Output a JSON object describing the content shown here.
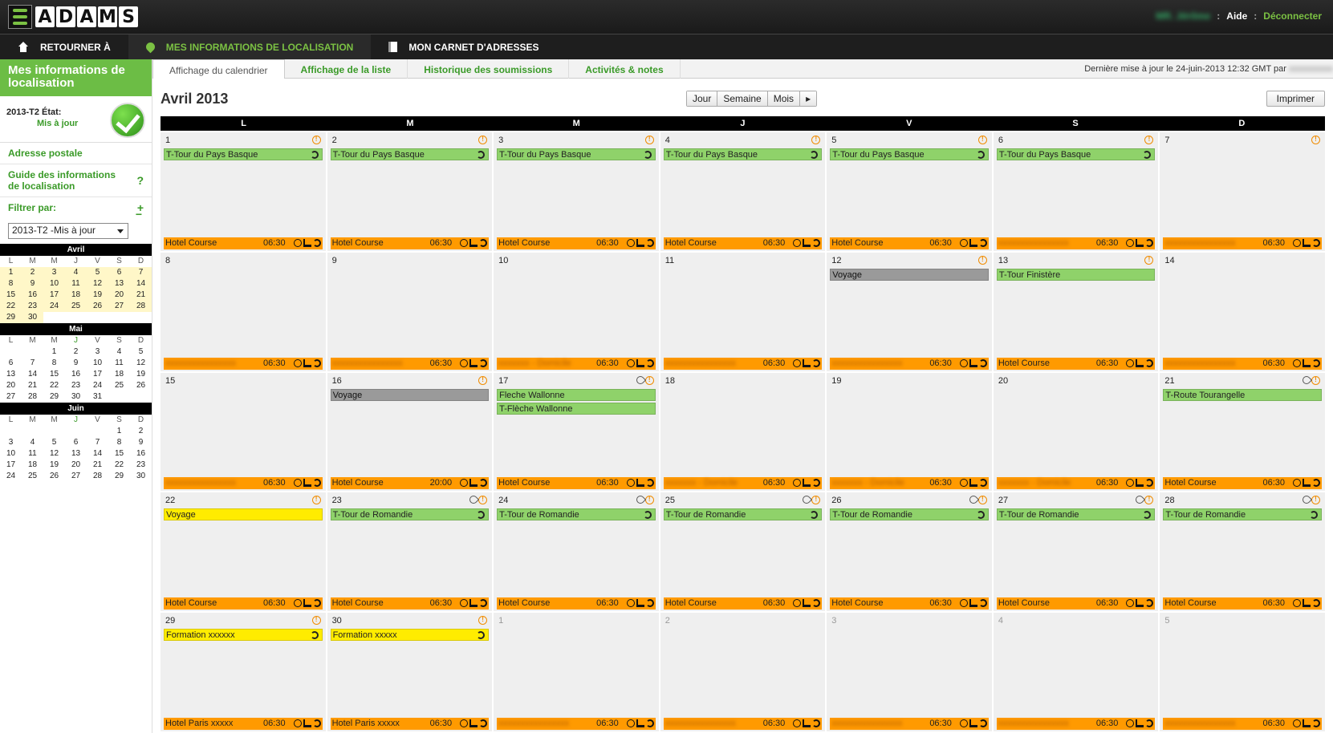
{
  "header": {
    "logo_letters": [
      "A",
      "D",
      "A",
      "M",
      "S"
    ],
    "user": "MR. Jérôme",
    "separator": ":",
    "help": "Aide",
    "logout": "Déconnecter"
  },
  "nav": [
    {
      "label": "RETOURNER À",
      "icon": "home-icon"
    },
    {
      "label": "MES INFORMATIONS DE LOCALISATION",
      "icon": "location-pin-icon",
      "active": true
    },
    {
      "label": "MON CARNET D'ADRESSES",
      "icon": "address-book-icon"
    }
  ],
  "sidebar": {
    "title": "Mes informations de localisation",
    "state_label": "2013-T2 État:",
    "state_value": "Mis à jour",
    "postal": "Adresse postale",
    "guide": "Guide des informations de localisation",
    "guide_side": "?",
    "filter": "Filtrer par:",
    "filter_plus": "+",
    "filter_minus": "−",
    "filter_value": "2013-T2 -Mis à jour"
  },
  "minical": {
    "dow": [
      "L",
      "M",
      "M",
      "J",
      "V",
      "S",
      "D"
    ],
    "months": [
      {
        "name": "Avril",
        "weeks": [
          [
            "1",
            "2",
            "3",
            "4",
            "5",
            "6",
            "7"
          ],
          [
            "8",
            "9",
            "10",
            "11",
            "12",
            "13",
            "14"
          ],
          [
            "15",
            "16",
            "17",
            "18",
            "19",
            "20",
            "21"
          ],
          [
            "22",
            "23",
            "24",
            "25",
            "26",
            "27",
            "28"
          ],
          [
            "29",
            "30",
            "",
            "",
            "",
            "",
            ""
          ]
        ]
      },
      {
        "name": "Mai",
        "weeks": [
          [
            "",
            "",
            "1",
            "2",
            "3",
            "4",
            "5"
          ],
          [
            "6",
            "7",
            "8",
            "9",
            "10",
            "11",
            "12"
          ],
          [
            "13",
            "14",
            "15",
            "16",
            "17",
            "18",
            "19"
          ],
          [
            "20",
            "21",
            "22",
            "23",
            "24",
            "25",
            "26"
          ],
          [
            "27",
            "28",
            "29",
            "30",
            "31",
            "",
            ""
          ]
        ]
      },
      {
        "name": "Juin",
        "weeks": [
          [
            "",
            "",
            "",
            "",
            "",
            "1",
            "2"
          ],
          [
            "3",
            "4",
            "5",
            "6",
            "7",
            "8",
            "9"
          ],
          [
            "10",
            "11",
            "12",
            "13",
            "14",
            "15",
            "16"
          ],
          [
            "17",
            "18",
            "19",
            "20",
            "21",
            "22",
            "23"
          ],
          [
            "24",
            "25",
            "26",
            "27",
            "28",
            "29",
            "30"
          ]
        ]
      }
    ]
  },
  "tabs": [
    "Affichage du calendrier",
    "Affichage de la liste",
    "Historique des soumissions",
    "Activités & notes"
  ],
  "last_update": "Dernière mise à jour le 24-juin-2013 12:32 GMT par",
  "last_update_user": "xxxxxxxxxx",
  "calendar": {
    "title": "Avril 2013",
    "views": [
      "Jour",
      "Semaine",
      "Mois",
      "▸"
    ],
    "print": "Imprimer",
    "dow": [
      "L",
      "M",
      "M",
      "J",
      "V",
      "S",
      "D"
    ],
    "cells": [
      {
        "n": "1",
        "warn": true,
        "events": [
          {
            "t": "T-Tour du Pays Basque",
            "c": "green",
            "rot": true
          }
        ],
        "bar": {
          "label": "Hotel Course",
          "time": "06:30"
        }
      },
      {
        "n": "2",
        "warn": true,
        "events": [
          {
            "t": "T-Tour du Pays Basque",
            "c": "green",
            "rot": true
          }
        ],
        "bar": {
          "label": "Hotel Course",
          "time": "06:30"
        }
      },
      {
        "n": "3",
        "warn": true,
        "events": [
          {
            "t": "T-Tour du Pays Basque",
            "c": "green",
            "rot": true
          }
        ],
        "bar": {
          "label": "Hotel Course",
          "time": "06:30"
        }
      },
      {
        "n": "4",
        "warn": true,
        "events": [
          {
            "t": "T-Tour du Pays Basque",
            "c": "green",
            "rot": true
          }
        ],
        "bar": {
          "label": "Hotel Course",
          "time": "06:30"
        }
      },
      {
        "n": "5",
        "warn": true,
        "events": [
          {
            "t": "T-Tour du Pays Basque",
            "c": "green",
            "rot": true
          }
        ],
        "bar": {
          "label": "Hotel Course",
          "time": "06:30"
        }
      },
      {
        "n": "6",
        "warn": true,
        "events": [
          {
            "t": "T-Tour du Pays Basque",
            "c": "green",
            "rot": true
          }
        ],
        "bar": {
          "label": "xxxxxxxxxxxxxxxx",
          "time": "06:30",
          "redact": true
        }
      },
      {
        "n": "7",
        "warn": true,
        "events": [],
        "bar": {
          "label": "xxxxxxxxxxxxxxxx",
          "time": "06:30",
          "redact": true
        }
      },
      {
        "n": "8",
        "events": [],
        "bar": {
          "label": "xxxxxxxxxxxxxxxx",
          "time": "06:30",
          "redact": true
        }
      },
      {
        "n": "9",
        "events": [],
        "bar": {
          "label": "xxxxxxxxxxxxxxxx",
          "time": "06:30",
          "redact": true
        }
      },
      {
        "n": "10",
        "events": [],
        "bar": {
          "label": "xxxxxxx - Domicile",
          "time": "06:30",
          "redact": true
        }
      },
      {
        "n": "11",
        "events": [],
        "bar": {
          "label": "xxxxxxxxxxxxxxxx",
          "time": "06:30",
          "redact": true
        }
      },
      {
        "n": "12",
        "warn": true,
        "events": [
          {
            "t": "Voyage",
            "c": "gray"
          }
        ],
        "bar": {
          "label": "xxxxxxxxxxxxxxxx",
          "time": "06:30",
          "redact": true
        }
      },
      {
        "n": "13",
        "warn": true,
        "events": [
          {
            "t": "T-Tour Finistère",
            "c": "green"
          }
        ],
        "bar": {
          "label": "Hotel Course",
          "time": "06:30"
        }
      },
      {
        "n": "14",
        "events": [],
        "bar": {
          "label": "xxxxxxxxxxxxxxxx",
          "time": "06:30",
          "redact": true
        }
      },
      {
        "n": "15",
        "events": [],
        "bar": {
          "label": "xxxxxxxxxxxxxxxx",
          "time": "06:30",
          "redact": true
        }
      },
      {
        "n": "16",
        "warn": true,
        "events": [
          {
            "t": "Voyage",
            "c": "gray"
          }
        ],
        "bar": {
          "label": "Hotel Course",
          "time": "20:00"
        }
      },
      {
        "n": "17",
        "warn": true,
        "clip": true,
        "events": [
          {
            "t": "Fleche Wallonne",
            "c": "green"
          },
          {
            "t": "T-Flèche Wallonne",
            "c": "green"
          }
        ],
        "bar": {
          "label": "Hotel Course",
          "time": "06:30"
        }
      },
      {
        "n": "18",
        "events": [],
        "bar": {
          "label": "xxxxxxx - Domicile",
          "time": "06:30",
          "redact": true
        }
      },
      {
        "n": "19",
        "events": [],
        "bar": {
          "label": "xxxxxxx - Domicile",
          "time": "06:30",
          "redact": true
        }
      },
      {
        "n": "20",
        "events": [],
        "bar": {
          "label": "xxxxxxx - Domicile",
          "time": "06:30",
          "redact": true
        }
      },
      {
        "n": "21",
        "warn": true,
        "clip": true,
        "events": [
          {
            "t": "T-Route Tourangelle",
            "c": "green"
          }
        ],
        "bar": {
          "label": "Hotel Course",
          "time": "06:30"
        }
      },
      {
        "n": "22",
        "warn": true,
        "events": [
          {
            "t": "Voyage",
            "c": "yellow"
          }
        ],
        "bar": {
          "label": "Hotel Course",
          "time": "06:30"
        }
      },
      {
        "n": "23",
        "warn": true,
        "clip": true,
        "events": [
          {
            "t": "T-Tour de Romandie",
            "c": "green",
            "rot": true
          }
        ],
        "bar": {
          "label": "Hotel Course",
          "time": "06:30"
        }
      },
      {
        "n": "24",
        "warn": true,
        "clip": true,
        "events": [
          {
            "t": "T-Tour de Romandie",
            "c": "green",
            "rot": true
          }
        ],
        "bar": {
          "label": "Hotel Course",
          "time": "06:30"
        }
      },
      {
        "n": "25",
        "warn": true,
        "clip": true,
        "events": [
          {
            "t": "T-Tour de Romandie",
            "c": "green",
            "rot": true
          }
        ],
        "bar": {
          "label": "Hotel Course",
          "time": "06:30"
        }
      },
      {
        "n": "26",
        "warn": true,
        "clip": true,
        "events": [
          {
            "t": "T-Tour de Romandie",
            "c": "green",
            "rot": true
          }
        ],
        "bar": {
          "label": "Hotel Course",
          "time": "06:30"
        }
      },
      {
        "n": "27",
        "warn": true,
        "clip": true,
        "events": [
          {
            "t": "T-Tour de Romandie",
            "c": "green",
            "rot": true
          }
        ],
        "bar": {
          "label": "Hotel Course",
          "time": "06:30"
        }
      },
      {
        "n": "28",
        "warn": true,
        "clip": true,
        "events": [
          {
            "t": "T-Tour de Romandie",
            "c": "green",
            "rot": true
          }
        ],
        "bar": {
          "label": "Hotel Course",
          "time": "06:30"
        }
      },
      {
        "n": "29",
        "warn": true,
        "events": [
          {
            "t": "Formation xxxxxx",
            "c": "yellow",
            "rot": true
          }
        ],
        "bar": {
          "label": "Hotel Paris xxxxx",
          "time": "06:30"
        }
      },
      {
        "n": "30",
        "warn": true,
        "events": [
          {
            "t": "Formation xxxxx",
            "c": "yellow",
            "rot": true
          }
        ],
        "bar": {
          "label": "Hotel Paris xxxxx",
          "time": "06:30"
        }
      },
      {
        "n": "1",
        "other": true,
        "events": [],
        "bar": {
          "label": "xxxxxxxxxxxxxxxx",
          "time": "06:30",
          "redact": true
        }
      },
      {
        "n": "2",
        "other": true,
        "events": [],
        "bar": {
          "label": "xxxxxxxxxxxxxxxx",
          "time": "06:30",
          "redact": true
        }
      },
      {
        "n": "3",
        "other": true,
        "events": [],
        "bar": {
          "label": "xxxxxxxxxxxxxxxx",
          "time": "06:30",
          "redact": true
        }
      },
      {
        "n": "4",
        "other": true,
        "events": [],
        "bar": {
          "label": "xxxxxxxxxxxxxxxx",
          "time": "06:30",
          "redact": true
        }
      },
      {
        "n": "5",
        "other": true,
        "events": [],
        "bar": {
          "label": "xxxxxxxxxxxxxxxx",
          "time": "06:30",
          "redact": true
        }
      }
    ]
  },
  "colors": {
    "green": "#6cbd45",
    "orange": "#ff9a00",
    "event_green": "#8fd26a",
    "yellow": "#ffec00"
  }
}
